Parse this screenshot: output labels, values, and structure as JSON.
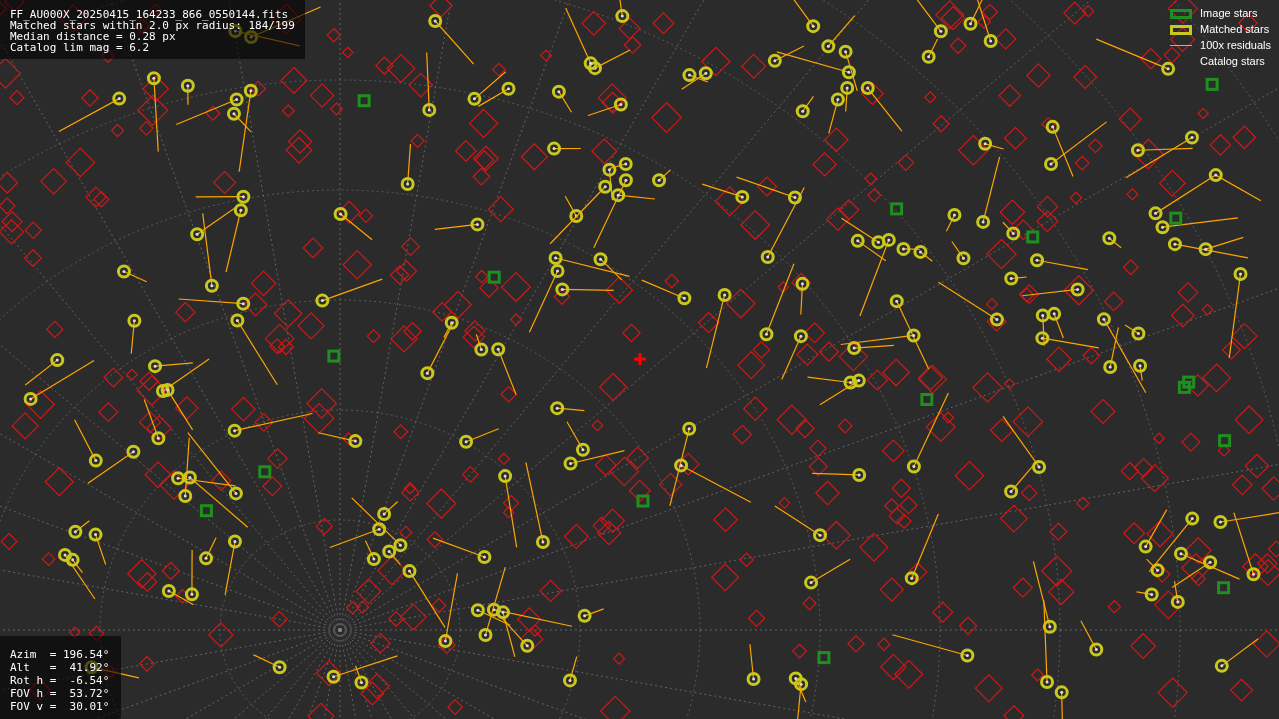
{
  "file_info": {
    "lines": [
      "FF_AU000X_20250415_164233_866_0550144.fits",
      "Matched stars within 2.0 px radius: 184/199",
      "Median distance = 0.28 px",
      "Catalog lim mag = 6.2"
    ]
  },
  "pointing": {
    "lines": [
      "Azim  = 196.54°",
      "Alt   =  41.92°",
      "Rot h =  -6.54°",
      "FOV h =  53.72°",
      "FOV v =  30.01°"
    ]
  },
  "legend": [
    {
      "kind": "image",
      "label": "Image stars"
    },
    {
      "kind": "matched",
      "label": "Matched stars"
    },
    {
      "kind": "residual",
      "label": "100x residuals"
    },
    {
      "kind": "catalog",
      "label": "Catalog stars"
    }
  ]
}
